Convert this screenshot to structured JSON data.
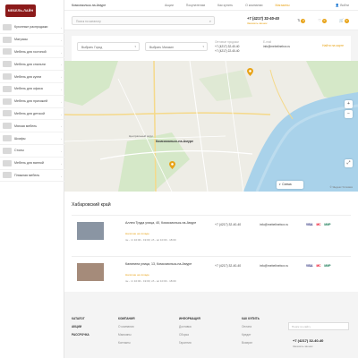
{
  "header": {
    "city": "Комсомольск-на-Амуре",
    "nav": [
      "Акции",
      "Покупателям",
      "Как купить",
      "О компании",
      "Магазины"
    ],
    "login": "Войти",
    "search_placeholder": "Поиск по каталогу",
    "phone": "+7 (4217) 32-40-40",
    "callback": "Заказать звонок",
    "compare_count": "0",
    "favorites_count": "0",
    "cart_count": "0"
  },
  "sidebar": {
    "logo_text": "МЕБЕЛЬ-ЛАЙН",
    "categories": [
      "Кухонные распродажи",
      "Матрасы",
      "Мебель для гостиной",
      "Мебель для спальни",
      "Мебель для кухни",
      "Мебель для офиса",
      "Мебель для прихожей",
      "Мебель для детской",
      "Мягкая мебель",
      "Шкафы",
      "Столы",
      "Мебель для ванной",
      "Пляжная мебель"
    ]
  },
  "contacts_panel": {
    "city_select": "Выбрать Город",
    "store_select": "Выбрать Магазин",
    "phone_label": "Оптовые продажи",
    "phones": [
      "+7 (4217) 32-40-40",
      "+7 (4217) 22-40-40"
    ],
    "email_label": "E-mail",
    "email": "info@mebelinebox.ru",
    "map_button": "Найти на карте"
  },
  "map": {
    "city_label": "Комсомольск-на-Амуре",
    "district_label": "Центральный округ",
    "scheme_button": "Схема",
    "copyright": "© Яндекс  Условия"
  },
  "stores": {
    "region_title": "Хабаровский край",
    "items": [
      {
        "address": "Аллея Труда улица, 40, Комсомольск-на-Амуре",
        "stock": "Наличие на складе",
        "hours": "пн - пт 10:00 - 19:00; сб - вс 10:00 - 18:00",
        "phone": "+7 (4217) 32-40-40",
        "email": "info@mebelinebox.ru",
        "payments": [
          "VISA",
          "MC",
          "МИР"
        ]
      },
      {
        "address": "Калинина улица, 13, Комсомольск-на-Амуре",
        "stock": "Наличие на складе",
        "hours": "пн - пт 10:00 - 19:00; сб - вс 10:00 - 18:00",
        "phone": "+7 (4217) 32-40-40",
        "email": "info@mebelinebox.ru",
        "payments": [
          "VISA",
          "MC",
          "МИР"
        ]
      }
    ]
  },
  "footer": {
    "col1": [
      "КАТАЛОГ",
      "АКЦИИ",
      "РАССРОЧКА"
    ],
    "col2_title": "КОМПАНИЯ",
    "col2": [
      "О компании",
      "Магазины",
      "Контакты"
    ],
    "col3_title": "ИНФОРМАЦИЯ",
    "col3": [
      "Доставка",
      "Сборка",
      "Гарантия"
    ],
    "col4_title": "КАК КУПИТЬ",
    "col4": [
      "Оплата",
      "Кредит",
      "Возврат"
    ],
    "search_placeholder": "Поиск по сайту",
    "phone": "+7 (4217) 32-40-40",
    "callback": "Заказать звонок"
  },
  "colors": {
    "accent": "#e8a317",
    "logo": "#8b1a1a"
  }
}
